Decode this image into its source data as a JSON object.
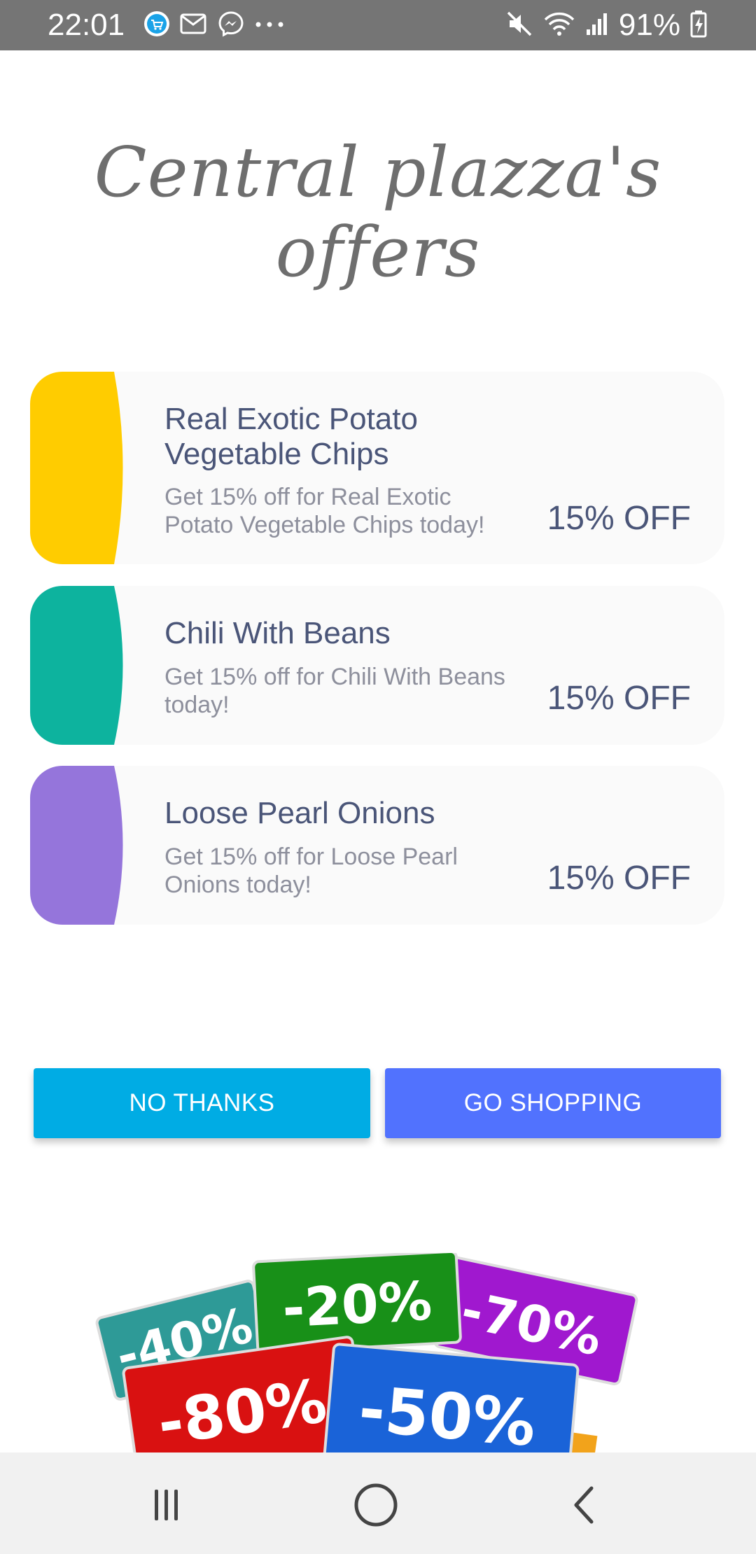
{
  "status_bar": {
    "time": "22:01",
    "battery": "91%",
    "left_icons": [
      "shopping-app-icon",
      "mail-icon",
      "messenger-icon",
      "more-dots-icon"
    ],
    "right_icons": [
      "mute-icon",
      "wifi-icon",
      "signal-icon",
      "battery-charging-icon"
    ]
  },
  "title": "Central plazza's offers",
  "offers": [
    {
      "name_line1": "Real Exotic Potato",
      "name_line2": "Vegetable Chips",
      "desc_line1": "Get 15% off for Real Exotic",
      "desc_line2": "Potato Vegetable Chips today!",
      "discount": "15% OFF",
      "color": "#ffcc00"
    },
    {
      "name_line1": "Chili With Beans",
      "desc_line1": "Get 15% off for Chili With Beans",
      "desc_line2": "today!",
      "discount": "15% OFF",
      "color": "#0db39e"
    },
    {
      "name_line1": "Loose Pearl Onions",
      "desc_line1": "Get 15% off for Loose Pearl",
      "desc_line2": "Onions today!",
      "discount": "15% OFF",
      "color": "#9575db"
    }
  ],
  "buttons": {
    "no_thanks": "NO THANKS",
    "go_shopping": "GO SHOPPING"
  },
  "discount_tags": [
    "-40%",
    "-20%",
    "-70%",
    "-80%",
    "-50%"
  ],
  "nav": [
    "recent-apps-icon",
    "home-icon",
    "back-icon"
  ]
}
